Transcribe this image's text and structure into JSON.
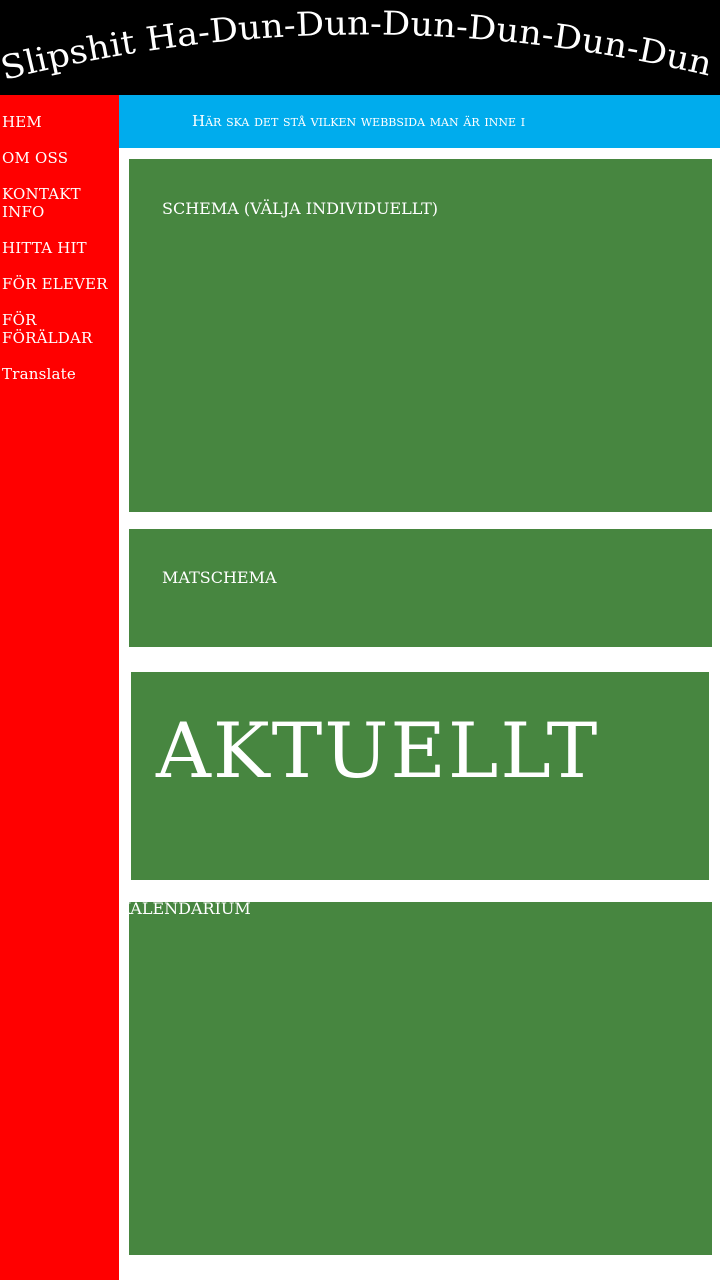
{
  "header": {
    "title": "Slipshit Ha-Dun-Dun-Dun-Dun-Dun-Dun"
  },
  "sidebar": {
    "items": [
      {
        "label": "HEM"
      },
      {
        "label": "OM OSS"
      },
      {
        "label": "KONTAKT INFO"
      },
      {
        "label": "HITTA HIT"
      },
      {
        "label": "FÖR ELEVER"
      },
      {
        "label": "FÖR FÖRÄLDAR"
      },
      {
        "label": "Translate"
      }
    ]
  },
  "topbar": {
    "text": "Här ska det stå vilken webbsida man är inne i"
  },
  "main": {
    "schema_label": "SCHEMA (VÄLJA INDIVIDUELLT)",
    "matschema_label": "MATSCHEMA",
    "aktuellt_label": "AKTUELLT",
    "kalendarium_label": "KALENDARIUM"
  },
  "colors": {
    "header_bg": "#000000",
    "sidebar_bg": "#ff0000",
    "topbar_bg": "#00aced",
    "panel_bg": "#478640",
    "text": "#ffffff"
  }
}
